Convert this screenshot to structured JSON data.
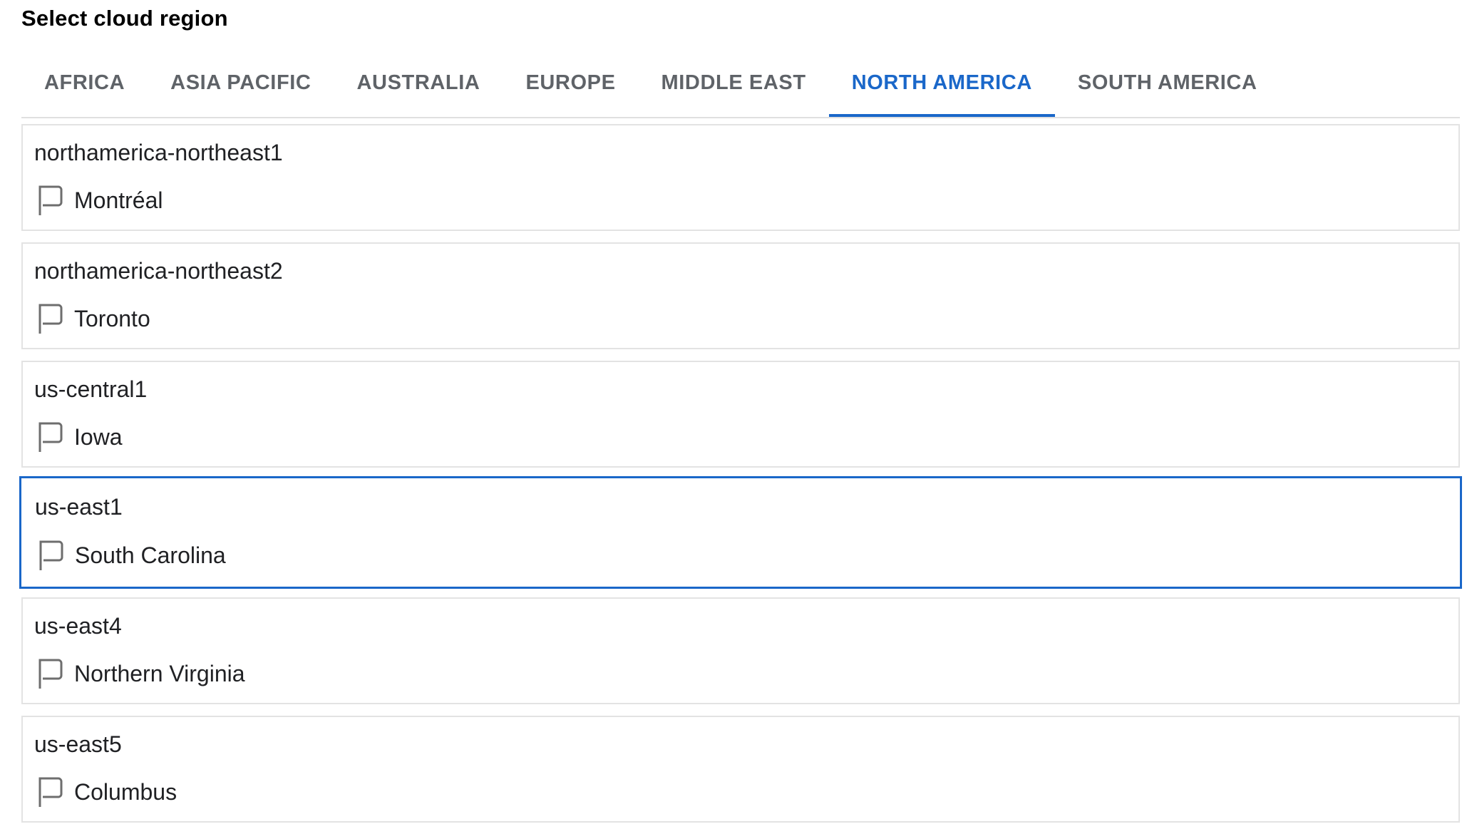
{
  "page": {
    "title": "Select cloud region"
  },
  "tabs": [
    {
      "label": "AFRICA",
      "active": false
    },
    {
      "label": "ASIA PACIFIC",
      "active": false
    },
    {
      "label": "AUSTRALIA",
      "active": false
    },
    {
      "label": "EUROPE",
      "active": false
    },
    {
      "label": "MIDDLE EAST",
      "active": false
    },
    {
      "label": "NORTH AMERICA",
      "active": true
    },
    {
      "label": "SOUTH AMERICA",
      "active": false
    }
  ],
  "regions": [
    {
      "code": "northamerica-northeast1",
      "location": "Montréal",
      "icon": "flag-icon",
      "selected": false
    },
    {
      "code": "northamerica-northeast2",
      "location": "Toronto",
      "icon": "flag-icon",
      "selected": false
    },
    {
      "code": "us-central1",
      "location": "Iowa",
      "icon": "flag-icon",
      "selected": false
    },
    {
      "code": "us-east1",
      "location": "South Carolina",
      "icon": "flag-icon",
      "selected": true
    },
    {
      "code": "us-east4",
      "location": "Northern Virginia",
      "icon": "flag-icon",
      "selected": false
    },
    {
      "code": "us-east5",
      "location": "Columbus",
      "icon": "flag-icon",
      "selected": false
    }
  ],
  "colors": {
    "accent": "#1a67c9",
    "tab_inactive": "#5f6368",
    "card_border": "#e3e3e3",
    "text": "#202124"
  }
}
